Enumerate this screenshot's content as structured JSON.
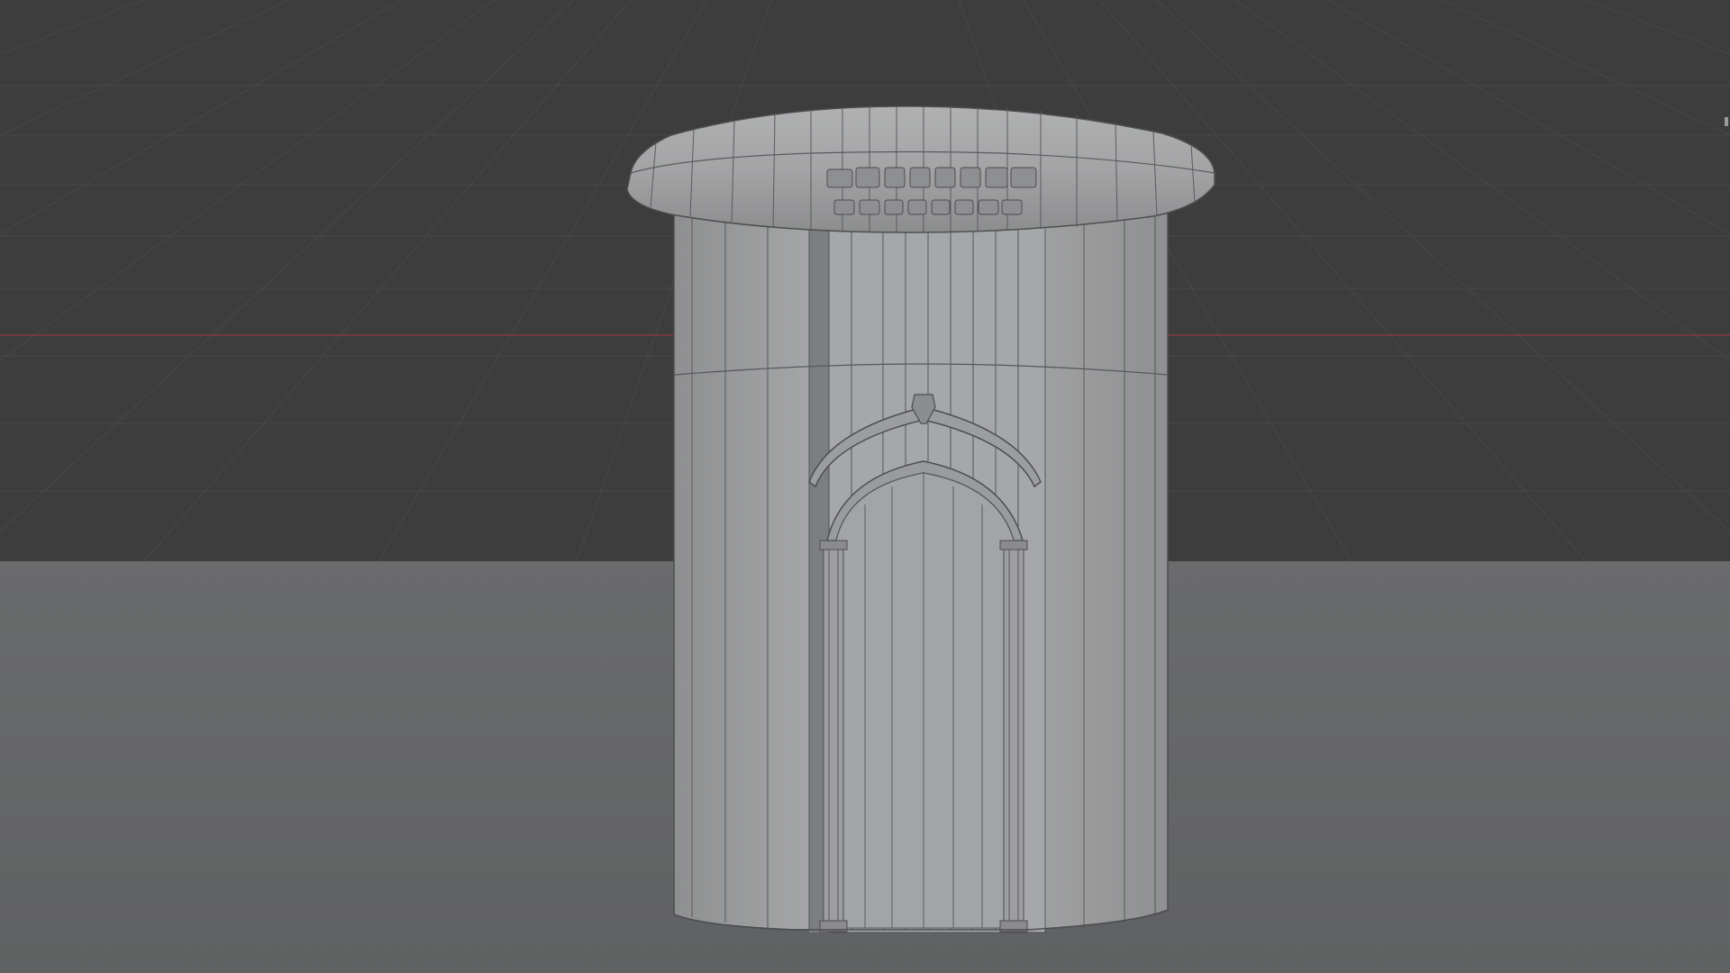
{
  "app": {
    "name": "3D viewport",
    "view": "solid-wireframe"
  },
  "scene": {
    "object": "cylindrical-tower-with-arched-doorway",
    "background_colors": {
      "sky": "#3d3d3d",
      "ground": "#656667",
      "grid_line": "#4a4a4a",
      "x_axis": "#8a3a44",
      "model_face": "#9a9b9c",
      "model_face_light": "#a7a8a9",
      "model_edge": "#4d4e50"
    },
    "icons": [
      "viewport-gizmo-icon"
    ]
  }
}
